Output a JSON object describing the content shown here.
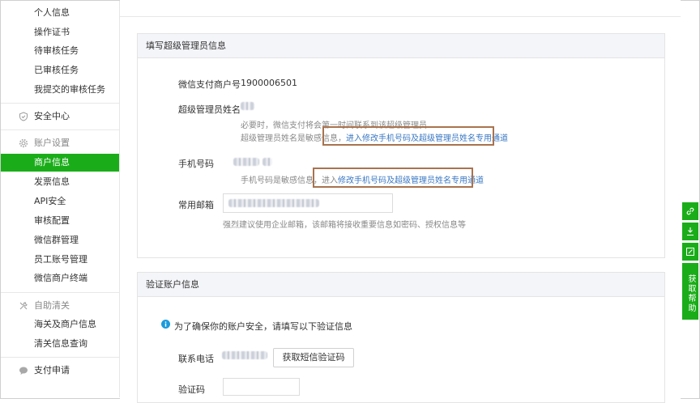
{
  "sidebar": {
    "items_top": [
      {
        "label": "个人信息"
      },
      {
        "label": "操作证书"
      },
      {
        "label": "待审核任务"
      },
      {
        "label": "已审核任务"
      },
      {
        "label": "我提交的审核任务"
      }
    ],
    "security_label": "安全中心",
    "account_group_label": "账户设置",
    "account_items": [
      {
        "label": "商户信息",
        "active": true
      },
      {
        "label": "发票信息"
      },
      {
        "label": "API安全"
      },
      {
        "label": "审核配置"
      },
      {
        "label": "微信群管理"
      },
      {
        "label": "员工账号管理"
      },
      {
        "label": "微信商户终端"
      }
    ],
    "customs_group_label": "自助清关",
    "customs_items": [
      {
        "label": "海关及商户信息"
      },
      {
        "label": "清关信息查询"
      }
    ],
    "pay_apply_label": "支付申请",
    "accent_color": "#1aad19"
  },
  "admin_panel": {
    "title": "填写超级管理员信息",
    "merchant_id_label": "微信支付商户号",
    "merchant_id_value": "1900006501",
    "admin_name_label": "超级管理员姓名",
    "admin_name_hint1": "必要时，微信支付将会第一时间联系到该超级管理员",
    "admin_name_hint2_prefix": "超级管理员姓名是敏感信息，",
    "admin_name_hint2_link": "进入修改手机号码及超级管理员姓名专用通道",
    "phone_label": "手机号码",
    "phone_hint_prefix": "手机号码是敏感信息，进入",
    "phone_hint_link": "修改手机号码及超级管理员姓名专用通道",
    "email_label": "常用邮箱",
    "email_hint": "强烈建议使用企业邮箱，该邮箱将接收重要信息如密码、授权信息等"
  },
  "verify_panel": {
    "title": "验证账户信息",
    "notice": "为了确保你的账户安全，请填写以下验证信息",
    "contact_phone_label": "联系电话",
    "get_code_button": "获取短信验证码",
    "code_label": "验证码"
  },
  "help_rail": {
    "help_label": "获取帮助"
  }
}
